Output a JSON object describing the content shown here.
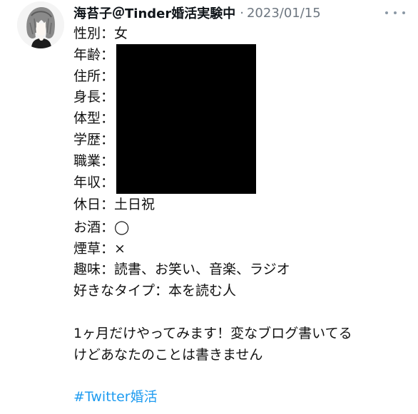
{
  "author": {
    "name": "海苔子＠Tinder婚活実験中",
    "separator": "·",
    "date": "2023/01/15"
  },
  "profile_lines": [
    "性別：女",
    "年齢：",
    "住所：",
    "身長：",
    "体型：",
    "学歴：",
    "職業：",
    "年収：",
    "休日：土日祝",
    "お酒：◯",
    "煙草：×",
    "趣味：読書、お笑い、音楽、ラジオ",
    "好きなタイプ：本を読む人"
  ],
  "message_lines": [
    "1ヶ月だけやってみます！変なブログ書いてる",
    "けどあなたのことは書きません"
  ],
  "hashtag": "#Twitter婚活",
  "icons": {
    "more": "more-horizontal-icon",
    "avatar": "avatar-illustration"
  },
  "colors": {
    "hashtag": "#1d9bf0",
    "meta_text": "#6e7781",
    "redaction": "#000000"
  }
}
